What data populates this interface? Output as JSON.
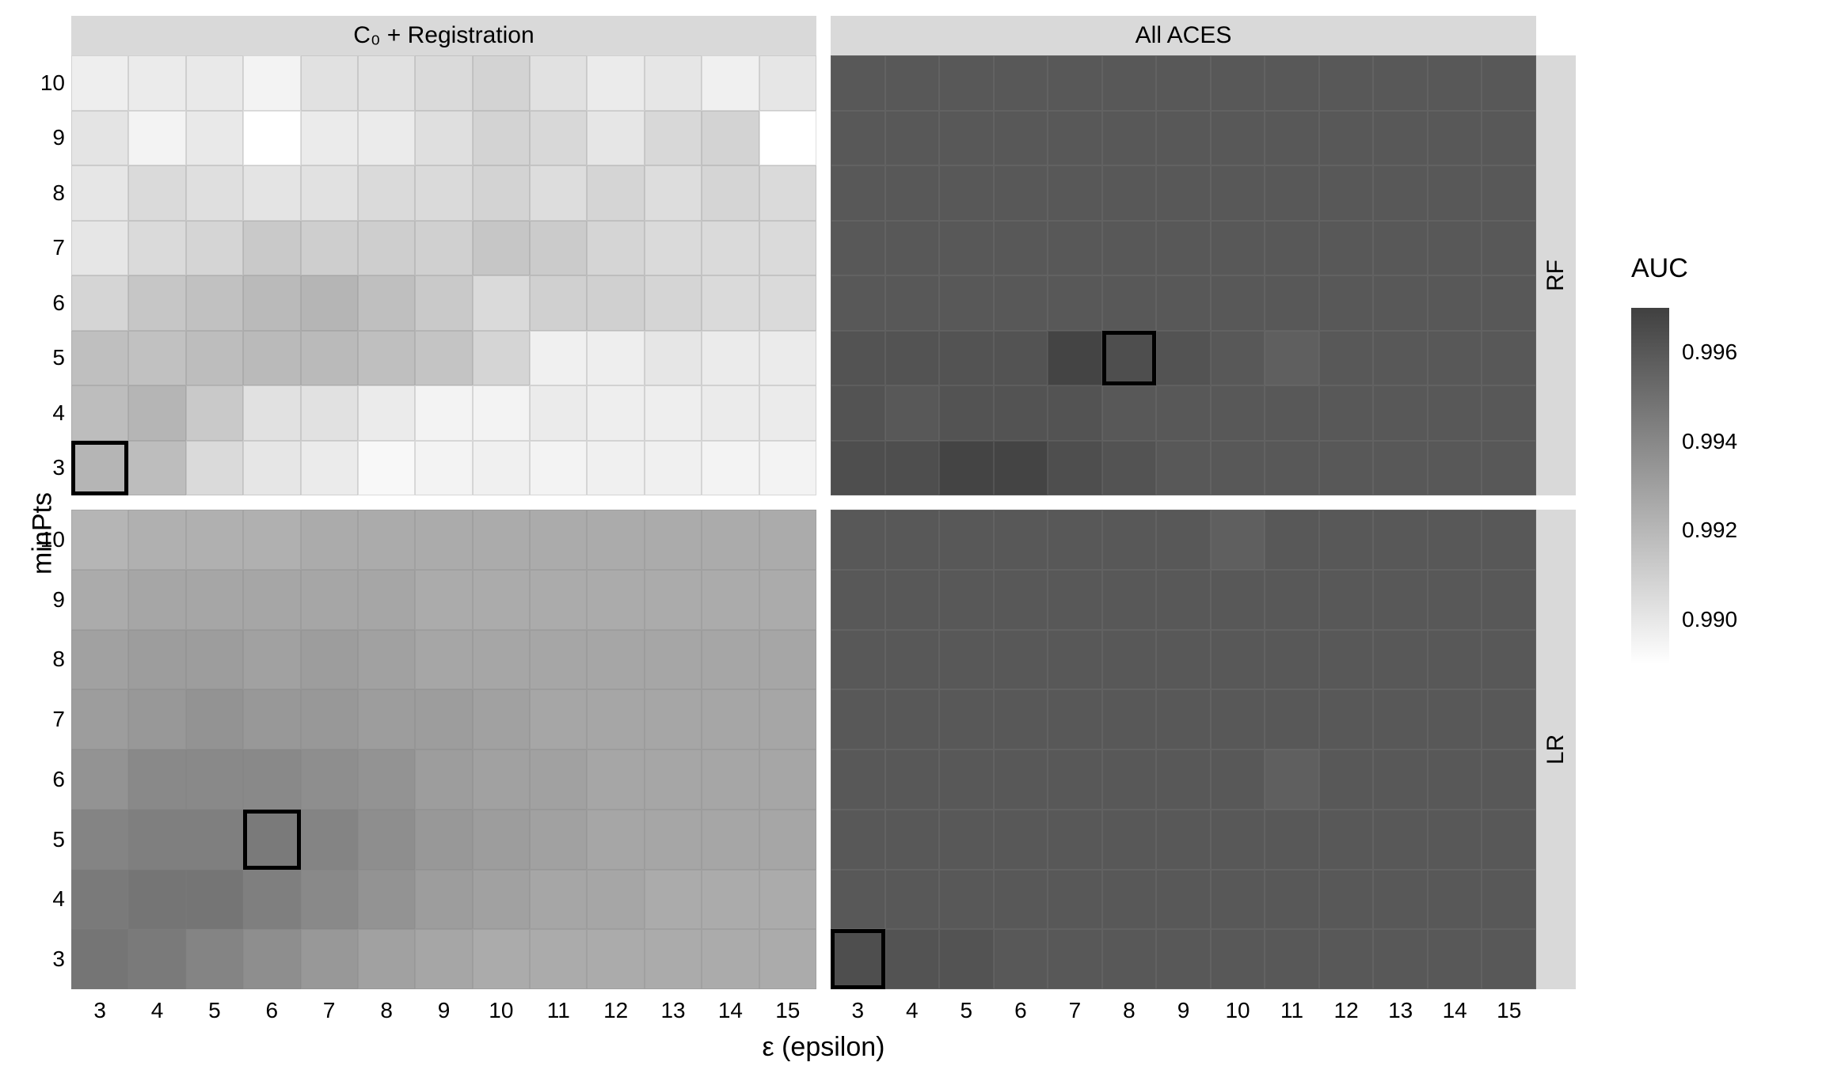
{
  "chart_data": {
    "type": "heatmap",
    "x_label": "ε (epsilon)",
    "y_label": "minPts",
    "x_values": [
      3,
      4,
      5,
      6,
      7,
      8,
      9,
      10,
      11,
      12,
      13,
      14,
      15
    ],
    "y_values": [
      3,
      4,
      5,
      6,
      7,
      8,
      9,
      10
    ],
    "col_facets": [
      "C₀ + Registration",
      "All ACES"
    ],
    "row_facets": [
      "RF",
      "LR"
    ],
    "legend_title": "AUC",
    "value_range": [
      0.989,
      0.997
    ],
    "legend_ticks": [
      0.99,
      0.992,
      0.994,
      0.996
    ],
    "panels": [
      {
        "col": "C₀ + Registration",
        "row": "RF",
        "highlight_cell": {
          "x": 3,
          "y": 3
        },
        "matrix": [
          [
            0.9897,
            0.9898,
            0.9899,
            0.9895,
            0.9902,
            0.9902,
            0.9905,
            0.9908,
            0.9902,
            0.9898,
            0.99,
            0.9896,
            0.99
          ],
          [
            0.9901,
            0.9895,
            0.9899,
            0.9889,
            0.9898,
            0.9898,
            0.9903,
            0.9908,
            0.9906,
            0.99,
            0.9906,
            0.9908,
            0.9888
          ],
          [
            0.99,
            0.9905,
            0.9903,
            0.9901,
            0.9902,
            0.9905,
            0.9905,
            0.9908,
            0.9904,
            0.9907,
            0.9904,
            0.9907,
            0.9905
          ],
          [
            0.99,
            0.9905,
            0.9907,
            0.9912,
            0.991,
            0.991,
            0.9909,
            0.9913,
            0.9911,
            0.9907,
            0.9905,
            0.9905,
            0.9905
          ],
          [
            0.9907,
            0.9913,
            0.9915,
            0.9918,
            0.992,
            0.9916,
            0.9912,
            0.9905,
            0.9909,
            0.9909,
            0.9907,
            0.9905,
            0.9905
          ],
          [
            0.9916,
            0.9915,
            0.9917,
            0.9918,
            0.9918,
            0.9916,
            0.9914,
            0.9907,
            0.9896,
            0.9897,
            0.99,
            0.9898,
            0.9898
          ],
          [
            0.9917,
            0.992,
            0.9912,
            0.9902,
            0.9902,
            0.9898,
            0.9895,
            0.9895,
            0.9898,
            0.9897,
            0.9897,
            0.9898,
            0.9898
          ],
          [
            0.992,
            0.9917,
            0.9905,
            0.99,
            0.9898,
            0.9893,
            0.9895,
            0.9896,
            0.9895,
            0.9896,
            0.9896,
            0.9895,
            0.9895
          ]
        ]
      },
      {
        "col": "All ACES",
        "row": "RF",
        "highlight_cell": {
          "x": 8,
          "y": 5
        },
        "matrix": [
          [
            0.9958,
            0.9958,
            0.9958,
            0.9958,
            0.9958,
            0.9958,
            0.9958,
            0.9958,
            0.9958,
            0.9958,
            0.9958,
            0.9958,
            0.9958
          ],
          [
            0.9958,
            0.9958,
            0.9958,
            0.9958,
            0.9958,
            0.9958,
            0.9958,
            0.9958,
            0.9958,
            0.9958,
            0.9958,
            0.9958,
            0.9958
          ],
          [
            0.9958,
            0.9958,
            0.9958,
            0.9958,
            0.9958,
            0.9958,
            0.9958,
            0.9958,
            0.9958,
            0.9958,
            0.9958,
            0.9958,
            0.9958
          ],
          [
            0.9958,
            0.9958,
            0.9958,
            0.9958,
            0.9958,
            0.9958,
            0.9958,
            0.9958,
            0.9958,
            0.9958,
            0.9958,
            0.9958,
            0.9958
          ],
          [
            0.9958,
            0.9958,
            0.9958,
            0.9958,
            0.9958,
            0.9958,
            0.9958,
            0.9958,
            0.9958,
            0.9958,
            0.9958,
            0.9958,
            0.9958
          ],
          [
            0.996,
            0.996,
            0.996,
            0.996,
            0.9966,
            0.9962,
            0.996,
            0.9958,
            0.9955,
            0.9958,
            0.9958,
            0.9958,
            0.9958
          ],
          [
            0.996,
            0.9958,
            0.996,
            0.996,
            0.996,
            0.9958,
            0.9958,
            0.9958,
            0.9958,
            0.9958,
            0.9958,
            0.9958,
            0.9958
          ],
          [
            0.9962,
            0.9962,
            0.9966,
            0.9966,
            0.9962,
            0.996,
            0.9958,
            0.9958,
            0.9958,
            0.9958,
            0.9958,
            0.9958,
            0.9958
          ]
        ]
      },
      {
        "col": "C₀ + Registration",
        "row": "LR",
        "highlight_cell": {
          "x": 6,
          "y": 5
        },
        "matrix": [
          [
            0.992,
            0.9922,
            0.9922,
            0.9922,
            0.9924,
            0.9924,
            0.9924,
            0.9924,
            0.9924,
            0.9924,
            0.9924,
            0.9924,
            0.9924
          ],
          [
            0.9924,
            0.9926,
            0.9926,
            0.9926,
            0.9926,
            0.9926,
            0.9924,
            0.9924,
            0.9924,
            0.9924,
            0.9924,
            0.9924,
            0.9924
          ],
          [
            0.9928,
            0.993,
            0.993,
            0.9928,
            0.993,
            0.9928,
            0.9926,
            0.9926,
            0.9926,
            0.9926,
            0.9926,
            0.9926,
            0.9926
          ],
          [
            0.993,
            0.9932,
            0.9934,
            0.9932,
            0.9932,
            0.993,
            0.993,
            0.9928,
            0.9926,
            0.9926,
            0.9926,
            0.9926,
            0.9926
          ],
          [
            0.9934,
            0.9938,
            0.9938,
            0.9938,
            0.9936,
            0.9934,
            0.993,
            0.9928,
            0.9928,
            0.9926,
            0.9926,
            0.9926,
            0.9926
          ],
          [
            0.994,
            0.9942,
            0.9942,
            0.9944,
            0.994,
            0.9936,
            0.9932,
            0.993,
            0.9928,
            0.9926,
            0.9926,
            0.9926,
            0.9926
          ],
          [
            0.9944,
            0.9946,
            0.9946,
            0.9942,
            0.9938,
            0.9934,
            0.993,
            0.9928,
            0.9926,
            0.9926,
            0.9924,
            0.9924,
            0.9924
          ],
          [
            0.9946,
            0.9944,
            0.994,
            0.9936,
            0.9932,
            0.9928,
            0.9926,
            0.9924,
            0.9924,
            0.9924,
            0.9924,
            0.9924,
            0.9924
          ]
        ]
      },
      {
        "col": "All ACES",
        "row": "LR",
        "highlight_cell": {
          "x": 3,
          "y": 3
        },
        "matrix": [
          [
            0.9958,
            0.9958,
            0.9958,
            0.9958,
            0.9958,
            0.9958,
            0.9958,
            0.9955,
            0.9958,
            0.9958,
            0.9958,
            0.9958,
            0.9958
          ],
          [
            0.9958,
            0.9958,
            0.9958,
            0.9958,
            0.9958,
            0.9958,
            0.9958,
            0.9958,
            0.9958,
            0.9958,
            0.9958,
            0.9958,
            0.9958
          ],
          [
            0.9958,
            0.9958,
            0.9958,
            0.9958,
            0.9958,
            0.9958,
            0.9958,
            0.9958,
            0.9958,
            0.9958,
            0.9958,
            0.9958,
            0.9958
          ],
          [
            0.9958,
            0.9958,
            0.9958,
            0.9958,
            0.9958,
            0.9958,
            0.9958,
            0.9958,
            0.9958,
            0.9958,
            0.9958,
            0.9958,
            0.9958
          ],
          [
            0.9958,
            0.9958,
            0.9958,
            0.9958,
            0.9958,
            0.9958,
            0.9958,
            0.9958,
            0.9955,
            0.9958,
            0.9958,
            0.9958,
            0.9958
          ],
          [
            0.9958,
            0.9958,
            0.9958,
            0.9958,
            0.9958,
            0.9958,
            0.9958,
            0.9958,
            0.9958,
            0.9958,
            0.9958,
            0.9958,
            0.9958
          ],
          [
            0.9958,
            0.9958,
            0.9958,
            0.9958,
            0.9958,
            0.9958,
            0.9958,
            0.9958,
            0.9958,
            0.9958,
            0.9958,
            0.9958,
            0.9958
          ],
          [
            0.9962,
            0.996,
            0.996,
            0.9958,
            0.9958,
            0.9958,
            0.9958,
            0.9958,
            0.9958,
            0.9958,
            0.9958,
            0.9958,
            0.9958
          ]
        ]
      }
    ]
  }
}
